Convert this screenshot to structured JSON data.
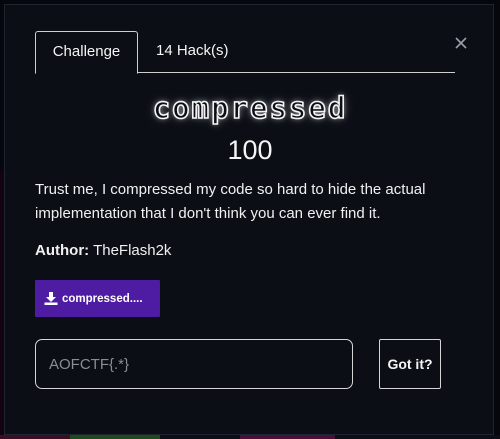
{
  "tabs": [
    {
      "label": "Challenge"
    },
    {
      "label": "14 Hack(s)"
    }
  ],
  "challenge": {
    "name": "compressed",
    "points": "100",
    "description": "Trust me, I compressed my code so hard to hide the actual implementation that I don't think you can ever find it.",
    "author_label": "Author:",
    "author_name": "TheFlash2k",
    "file_label": "compressed...."
  },
  "flag_input": {
    "placeholder": "AOFCTF{.*}",
    "value": ""
  },
  "submit_label": "Got it?",
  "icons": {
    "close": "close-icon",
    "download": "download-icon"
  },
  "colors": {
    "background": "#0b0e15",
    "file_button": "#4e1ba3",
    "border": "#cfcfcf"
  }
}
